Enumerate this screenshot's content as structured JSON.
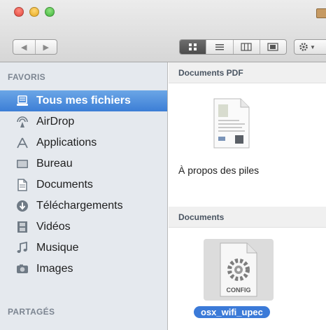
{
  "window": {
    "nav_back": "◀",
    "nav_forward": "▶"
  },
  "sidebar": {
    "favorites_header": "FAVORIS",
    "shared_header": "PARTAGÉS",
    "items": [
      {
        "label": "Tous mes fichiers",
        "icon": "all-files-icon",
        "selected": true
      },
      {
        "label": "AirDrop",
        "icon": "airdrop-icon"
      },
      {
        "label": "Applications",
        "icon": "applications-icon"
      },
      {
        "label": "Bureau",
        "icon": "desktop-icon"
      },
      {
        "label": "Documents",
        "icon": "documents-icon"
      },
      {
        "label": "Téléchargements",
        "icon": "downloads-icon"
      },
      {
        "label": "Vidéos",
        "icon": "movies-icon"
      },
      {
        "label": "Musique",
        "icon": "music-icon"
      },
      {
        "label": "Images",
        "icon": "pictures-icon"
      }
    ]
  },
  "content": {
    "groups": [
      {
        "title": "Documents PDF",
        "files": [
          {
            "name": "À propos des piles",
            "kind": "pdf"
          }
        ]
      },
      {
        "title": "Documents",
        "files": [
          {
            "name": "osx_wifi_upec",
            "kind": "config",
            "selected": true,
            "badge": "CONFIG"
          }
        ]
      }
    ]
  },
  "colors": {
    "selection": "#3c7ed6",
    "sidebar_bg": "#e5e9ee"
  }
}
